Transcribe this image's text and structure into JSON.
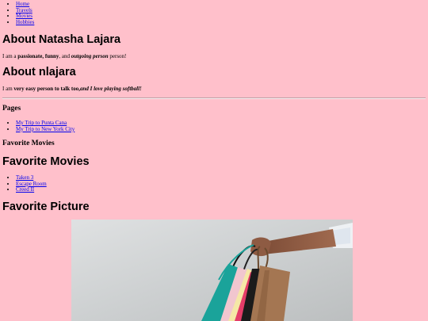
{
  "nav": {
    "items": [
      "Home",
      "Travels",
      "Movies",
      "Hobbies"
    ]
  },
  "about1": {
    "title": "About Natasha Lajara",
    "text_pre": "I am a ",
    "text_b1": "passionate, funny",
    "text_mid": ", and ",
    "text_b2i": "outgoing person",
    "text_post": " person!"
  },
  "about2": {
    "title": "About nlajara",
    "text_pre": "I am ",
    "text_b1": "very easy person to talk too,",
    "text_b2i": "and I love playing softball!"
  },
  "pages": {
    "title": "Pages",
    "links": [
      "My Trip to Punta Cana",
      "My Trip to New York City"
    ]
  },
  "fav_movies_small": {
    "title": "Favorite Movies"
  },
  "fav_movies": {
    "title": "Favorite Movies",
    "items": [
      "Taken 3",
      "Escape Room",
      "Creed II"
    ]
  },
  "fav_picture": {
    "title": "Favorite Picture",
    "image_subject": "shopping-bags-photo"
  },
  "colors": {
    "background": "#ffc0cb",
    "link": "#0000ee"
  }
}
